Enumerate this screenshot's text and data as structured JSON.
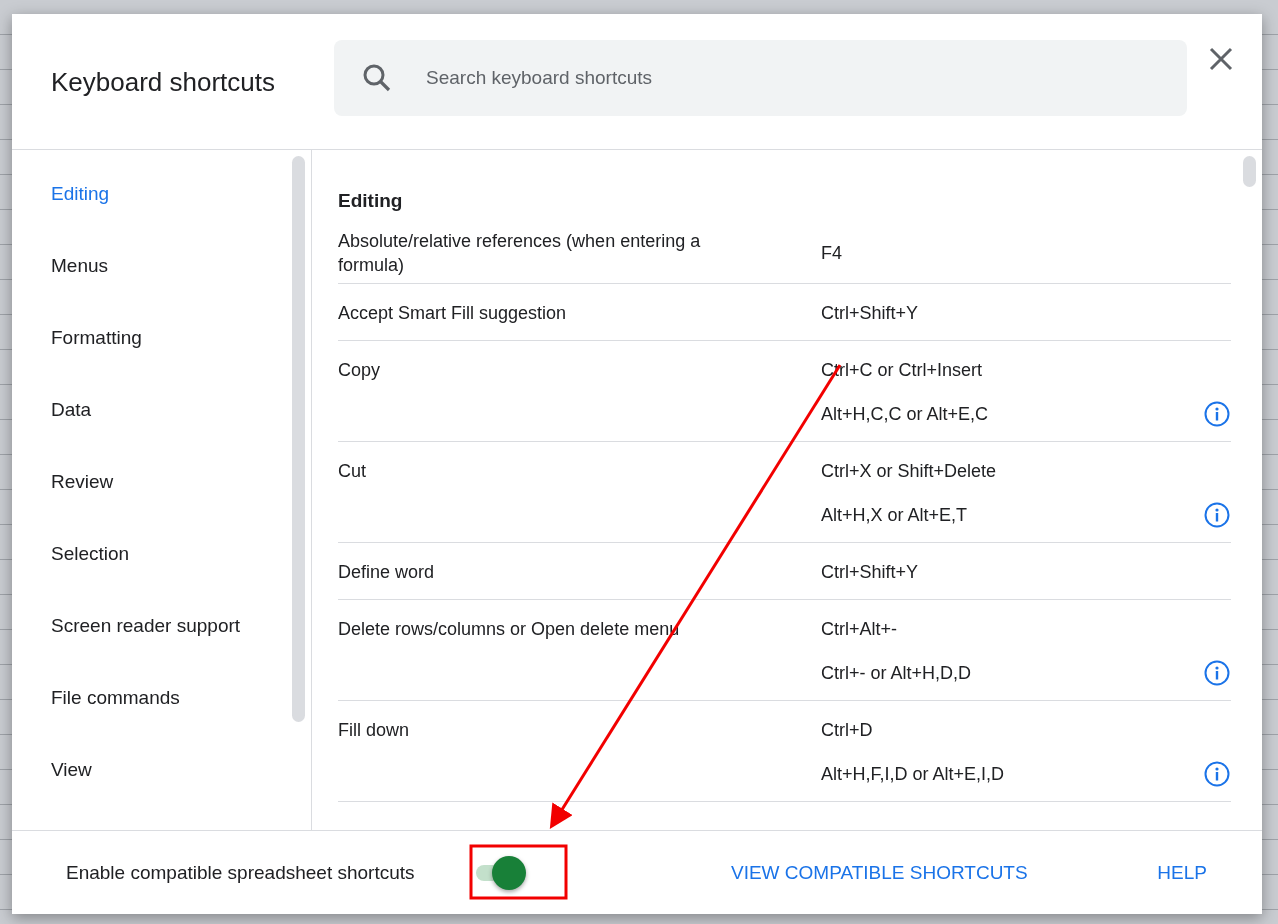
{
  "dialog": {
    "title": "Keyboard shortcuts",
    "search": {
      "placeholder": "Search keyboard shortcuts"
    }
  },
  "sidebar": {
    "items": [
      {
        "label": "Editing",
        "selected": true
      },
      {
        "label": "Menus",
        "selected": false
      },
      {
        "label": "Formatting",
        "selected": false
      },
      {
        "label": "Data",
        "selected": false
      },
      {
        "label": "Review",
        "selected": false
      },
      {
        "label": "Selection",
        "selected": false
      },
      {
        "label": "Screen reader support",
        "selected": false
      },
      {
        "label": "File commands",
        "selected": false
      },
      {
        "label": "View",
        "selected": false
      }
    ]
  },
  "section": {
    "heading": "Editing",
    "shortcuts": [
      {
        "action": "Absolute/relative references (when entering a formula)",
        "keys": [
          {
            "text": "F4",
            "info": false
          }
        ]
      },
      {
        "action": "Accept Smart Fill suggestion",
        "keys": [
          {
            "text": "Ctrl+Shift+Y",
            "info": false
          }
        ]
      },
      {
        "action": "Copy",
        "keys": [
          {
            "text": "Ctrl+C or Ctrl+Insert",
            "info": false
          },
          {
            "text": "Alt+H,C,C or Alt+E,C",
            "info": true
          }
        ]
      },
      {
        "action": "Cut",
        "keys": [
          {
            "text": "Ctrl+X or Shift+Delete",
            "info": false
          },
          {
            "text": "Alt+H,X or Alt+E,T",
            "info": true
          }
        ]
      },
      {
        "action": "Define word",
        "keys": [
          {
            "text": "Ctrl+Shift+Y",
            "info": false
          }
        ]
      },
      {
        "action": "Delete rows/columns or Open delete menu",
        "keys": [
          {
            "text": "Ctrl+Alt+-",
            "info": false
          },
          {
            "text": "Ctrl+- or Alt+H,D,D",
            "info": true
          }
        ]
      },
      {
        "action": "Fill down",
        "keys": [
          {
            "text": "Ctrl+D",
            "info": false
          },
          {
            "text": "Alt+H,F,I,D or Alt+E,I,D",
            "info": true
          }
        ]
      }
    ]
  },
  "footer": {
    "toggle": {
      "label": "Enable compatible spreadsheet shortcuts",
      "on": true
    },
    "links": [
      "VIEW COMPATIBLE SHORTCUTS",
      "HELP"
    ]
  }
}
